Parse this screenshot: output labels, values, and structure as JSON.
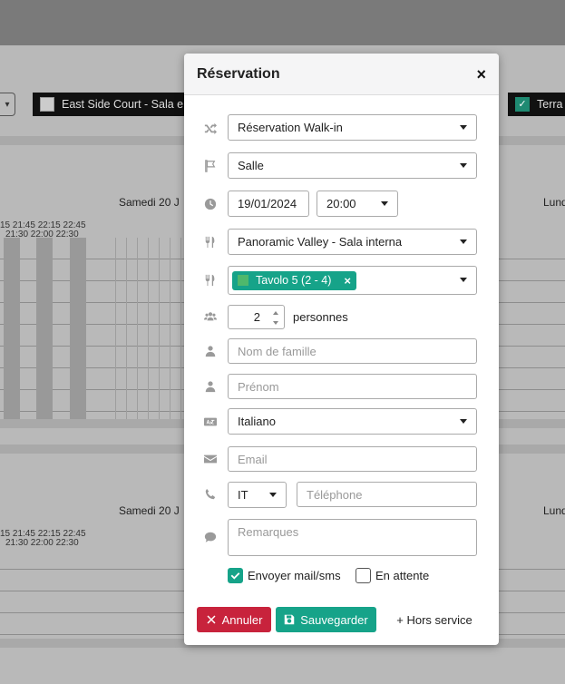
{
  "background": {
    "chips": [
      {
        "label": "East Side Court - Sala e",
        "checked": false
      },
      {
        "label": "Terra",
        "checked": true
      }
    ],
    "dates": {
      "top_left": "Samedi 20 J",
      "top_right": "Lund",
      "bottom_left": "Samedi 20 J",
      "bottom_right": "Lund"
    },
    "times_top": {
      "row1": "15   21:45   22:15   22:45",
      "row2": "21:30   22:00   22:30"
    },
    "times_bottom": {
      "row1": "15   21:45   22:15   22:45",
      "row2": "21:30   22:00   22:30"
    },
    "select_edge_symbol": "▾"
  },
  "modal": {
    "title": "Réservation",
    "close_symbol": "×",
    "reservation_type": "Réservation Walk-in",
    "room_type": "Salle",
    "date": "19/01/2024",
    "time": "20:00",
    "room": "Panoramic Valley - Sala interna",
    "table_tag": "Tavolo 5 (2 - 4)",
    "table_tag_remove": "×",
    "guests": "2",
    "guests_label": "personnes",
    "last_name_placeholder": "Nom de famille",
    "first_name_placeholder": "Prénom",
    "language": "Italiano",
    "email_placeholder": "Email",
    "phone_country": "IT",
    "phone_placeholder": "Téléphone",
    "notes_placeholder": "Remarques",
    "send_mail_label": "Envoyer mail/sms",
    "send_mail_checked": true,
    "pending_label": "En attente",
    "pending_checked": false,
    "cancel_label": "Annuler",
    "save_label": "Sauvegarder",
    "out_of_service_label": "+ Hors service"
  },
  "colors": {
    "accent": "#16a389",
    "danger": "#c8233c"
  }
}
